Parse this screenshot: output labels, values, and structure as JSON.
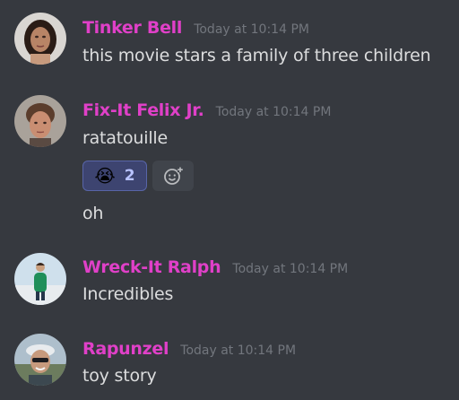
{
  "messages": [
    {
      "username": "Tinker Bell",
      "timestamp": "Today at 10:14 PM",
      "text": "this movie stars a family of three children",
      "avatar_icon": "user-avatar-tinker-bell"
    },
    {
      "username": "Fix-It Felix Jr.",
      "timestamp": "Today at 10:14 PM",
      "text": "ratatouille",
      "avatar_icon": "user-avatar-fix-it-felix",
      "reactions": [
        {
          "emoji": "😭",
          "emoji_name": "sob-emoji",
          "count": "2"
        }
      ],
      "followup_text": "oh"
    },
    {
      "username": "Wreck-It Ralph",
      "timestamp": "Today at 10:14 PM",
      "text": "Incredibles",
      "avatar_icon": "user-avatar-wreck-it-ralph"
    },
    {
      "username": "Rapunzel",
      "timestamp": "Today at 10:14 PM",
      "text": "toy story",
      "avatar_icon": "user-avatar-rapunzel"
    }
  ],
  "colors": {
    "background": "#36393f",
    "username": "#e040c8",
    "timestamp": "#72767d",
    "message_text": "#dcddde",
    "reaction_bg": "#3d4470",
    "reaction_border": "#5865a8",
    "reaction_count": "#b9c3ff"
  },
  "icons": {
    "add_reaction": "add-reaction-icon"
  }
}
